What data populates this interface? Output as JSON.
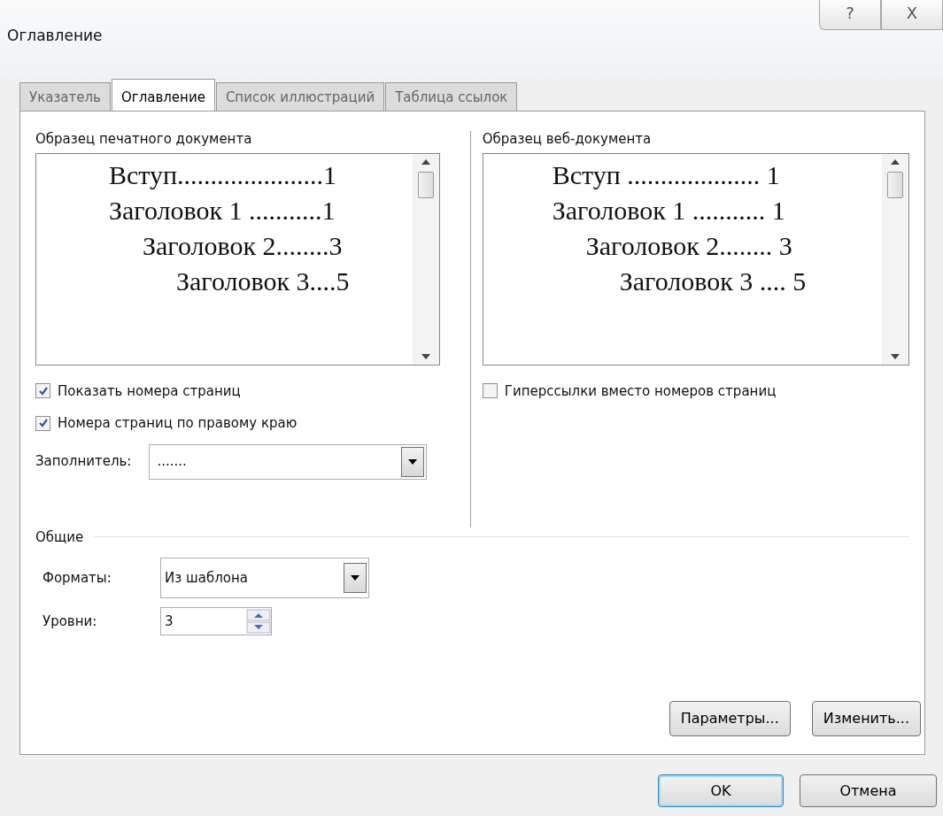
{
  "window": {
    "title": "Оглавление",
    "help": "?",
    "close": "X"
  },
  "tabs": [
    {
      "label": "Указатель",
      "selected": false
    },
    {
      "label": "Оглавление",
      "selected": true
    },
    {
      "label": "Список иллюстраций",
      "selected": false
    },
    {
      "label": "Таблица ссылок",
      "selected": false
    }
  ],
  "print_preview": {
    "label": "Образец печатного документа",
    "entries": [
      {
        "text": "Вступ......................1"
      },
      {
        "text": "Заголовок 1 ...........1",
        "children": [
          {
            "text": "Заголовок 2........3",
            "children": [
              {
                "text": "Заголовок 3....5"
              }
            ]
          }
        ]
      }
    ]
  },
  "web_preview": {
    "label": "Образец веб-документа",
    "entries": [
      {
        "text": "Вступ .................... 1"
      },
      {
        "text": "Заголовок 1 ........... 1",
        "children": [
          {
            "text": "Заголовок 2........ 3",
            "children": [
              {
                "text": "Заголовок 3 .... 5"
              }
            ]
          }
        ]
      }
    ]
  },
  "left_options": [
    {
      "label": "Показать номера страниц",
      "checked": true
    },
    {
      "label": "Номера страниц по правому краю",
      "checked": true
    }
  ],
  "right_options": [
    {
      "label": "Гиперссылки вместо номеров страниц",
      "checked": false
    }
  ],
  "filler": {
    "label": "Заполнитель:",
    "value": "......."
  },
  "general": {
    "title": "Общие",
    "formats_label": "Форматы:",
    "formats_value": "Из шаблона",
    "levels_label": "Уровни:",
    "levels_value": "3"
  },
  "panel_buttons": [
    "Параметры...",
    "Изменить..."
  ],
  "dialog_buttons": [
    {
      "label": "OK",
      "default": true
    },
    {
      "label": "Отмена",
      "default": false
    }
  ]
}
